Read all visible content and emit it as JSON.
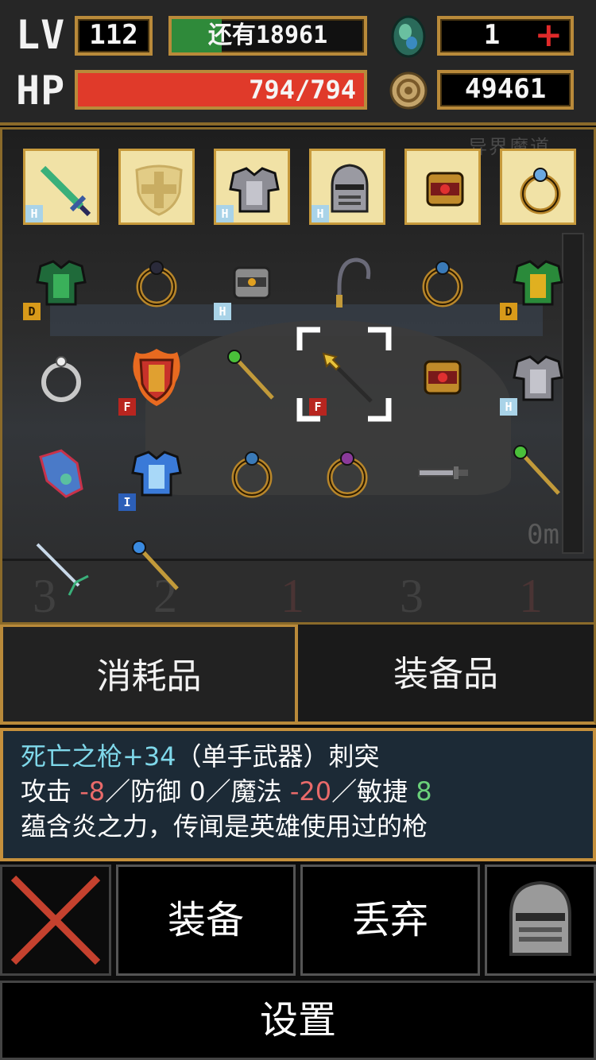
{
  "status": {
    "lv_label": "LV",
    "level": "112",
    "exp_remaining": "还有18961",
    "gem_count": "1",
    "plus_symbol": "+",
    "hp_label": "HP",
    "hp_text": "794/794",
    "hp_fraction": 1.0,
    "gold": "49461"
  },
  "inventory": {
    "bg_text": "异界魔道",
    "depth": "0m",
    "equipped": [
      {
        "icon": "green-sword-icon",
        "badge": "H"
      },
      {
        "icon": "empty-shield-slot-icon",
        "badge": ""
      },
      {
        "icon": "steel-armor-icon",
        "badge": "H"
      },
      {
        "icon": "knight-helmet-icon",
        "badge": "H"
      },
      {
        "icon": "ruby-bracelet-icon",
        "badge": ""
      },
      {
        "icon": "sapphire-ring-icon",
        "badge": ""
      }
    ],
    "items": [
      {
        "icon": "green-scale-armor-icon",
        "badge": "D"
      },
      {
        "icon": "dark-ring-icon",
        "badge": ""
      },
      {
        "icon": "steel-bracelet-icon",
        "badge": "H"
      },
      {
        "icon": "whip-icon",
        "badge": ""
      },
      {
        "icon": "blue-gem-ring-icon",
        "badge": ""
      },
      {
        "icon": "green-armor-icon",
        "badge": "D"
      },
      {
        "icon": "silver-ring-icon",
        "badge": ""
      },
      {
        "icon": "flame-shield-icon",
        "badge": "F"
      },
      {
        "icon": "green-staff-icon",
        "badge": ""
      },
      {
        "icon": "death-spear-icon",
        "badge": "F",
        "selected": true
      },
      {
        "icon": "ruby-bracelet-icon",
        "badge": ""
      },
      {
        "icon": "steel-armor-icon",
        "badge": "H"
      },
      {
        "icon": "gauntlet-icon",
        "badge": ""
      },
      {
        "icon": "blue-ice-armor-icon",
        "badge": "I"
      },
      {
        "icon": "blue-gem-ring-icon",
        "badge": ""
      },
      {
        "icon": "purple-gem-ring-icon",
        "badge": ""
      },
      {
        "icon": "dagger-icon",
        "badge": ""
      },
      {
        "icon": "green-staff-icon",
        "badge": ""
      },
      {
        "icon": "trident-icon",
        "badge": ""
      },
      {
        "icon": "gold-staff-icon",
        "badge": ""
      }
    ],
    "shelf_numbers": [
      "3",
      "2",
      "1",
      "3",
      "1"
    ]
  },
  "tabs": {
    "consumables": "消耗品",
    "equipment": "装备品"
  },
  "description": {
    "name": "死亡之枪+34",
    "type": "（单手武器）刺突",
    "attack_label": "攻击",
    "attack_value": "-8",
    "sep1": "／防御 0／魔法 ",
    "magic_value": "-20",
    "sep2": "／敏捷 ",
    "agility_value": "8",
    "flavor": "蕴含炎之力，传闻是英雄使用过的枪"
  },
  "actions": {
    "equip": "装备",
    "discard": "丢弃",
    "settings": "设置"
  },
  "colors": {
    "gold_frame": "#b98a3a",
    "hp_bar": "#e03a2a",
    "exp_bar": "#2f8a3a",
    "desc_bg": "#1c2a36"
  }
}
